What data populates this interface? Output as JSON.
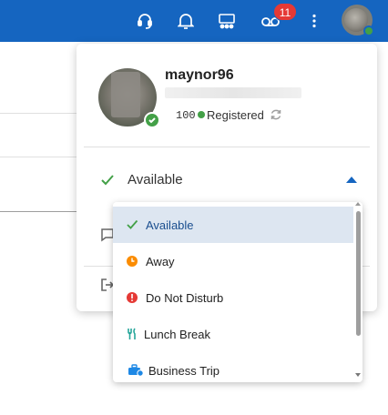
{
  "topbar": {
    "color": "#1565c0",
    "icons": [
      "headset-icon",
      "bell-icon",
      "meeting-room-icon",
      "voicemail-icon",
      "more-vert-icon"
    ],
    "voicemail_badge": "11"
  },
  "profile": {
    "username": "maynor96",
    "extension": "100",
    "registration_status": "Registered",
    "presence_color": "#43a047"
  },
  "status": {
    "current": "Available",
    "options": [
      {
        "label": "Available",
        "icon": "check-icon",
        "color": "#1565c0",
        "selected": true
      },
      {
        "label": "Away",
        "icon": "clock-icon",
        "color": "#fb8c00",
        "selected": false
      },
      {
        "label": "Do Not Disturb",
        "icon": "dnd-icon",
        "color": "#e53935",
        "selected": false
      },
      {
        "label": "Lunch Break",
        "icon": "utensils-icon",
        "color": "#26a69a",
        "selected": false
      },
      {
        "label": "Business Trip",
        "icon": "briefcase-icon",
        "color": "#1e88e5",
        "selected": false
      }
    ]
  }
}
